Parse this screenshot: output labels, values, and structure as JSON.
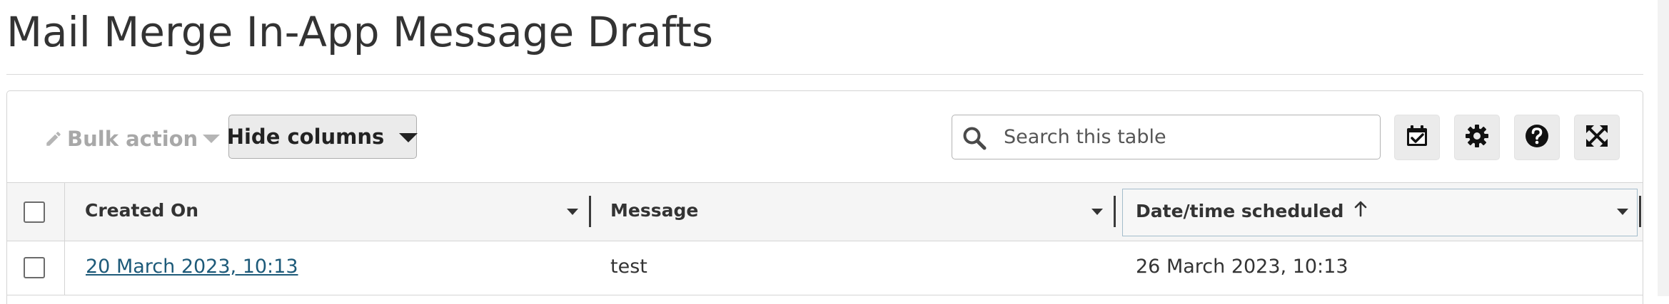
{
  "page": {
    "title": "Mail Merge In-App Message Drafts"
  },
  "toolbar": {
    "bulk_action_label": "Bulk action",
    "hide_columns_label": "Hide columns",
    "search_placeholder": "Search this table",
    "search_value": "",
    "icons": [
      "pencil-icon",
      "caret-down-icon",
      "search-icon",
      "calendar-check-icon",
      "gear-icon",
      "question-circle-icon",
      "expand-icon"
    ]
  },
  "table": {
    "columns": [
      {
        "label": "Created On",
        "sortable": true,
        "sorted": ""
      },
      {
        "label": "Message",
        "sortable": true,
        "sorted": ""
      },
      {
        "label": "Date/time scheduled",
        "sortable": true,
        "sorted": "ascending"
      }
    ],
    "rows": [
      {
        "selected": false,
        "created_on": "20 March 2023, 10:13",
        "message": "test",
        "scheduled": "26 March 2023, 10:13"
      }
    ]
  },
  "colors": {
    "link": "#1d5a79",
    "header_bg": "#f5f5f5",
    "button_bg": "#ebebeb",
    "disabled_text": "#a8a8a8",
    "sorted_border": "#a3bccb"
  }
}
